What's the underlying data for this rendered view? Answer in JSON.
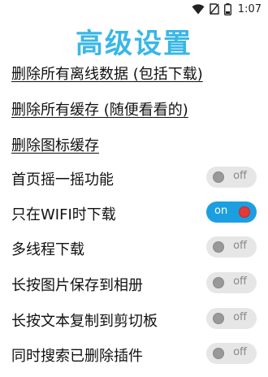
{
  "status_bar": {
    "time": "1:07",
    "battery_level": "1",
    "icons": [
      "wifi-icon",
      "no-sim-icon",
      "battery-icon"
    ]
  },
  "title": "高级设置",
  "links": [
    {
      "label": "删除所有离线数据 (包括下载)"
    },
    {
      "label": "删除所有缓存 (随便看看的)"
    },
    {
      "label": "删除图标缓存"
    }
  ],
  "settings": [
    {
      "label": "首页摇一摇功能",
      "state": "off"
    },
    {
      "label": "只在WIFI时下载",
      "state": "on"
    },
    {
      "label": "多线程下载",
      "state": "off"
    },
    {
      "label": "长按图片保存到相册",
      "state": "off"
    },
    {
      "label": "长按文本复制到剪切板",
      "state": "off"
    },
    {
      "label": "同时搜索已删除插件",
      "state": "off"
    }
  ],
  "colors": {
    "title": "#39b7e6",
    "toggle_on": "#1c9fe0",
    "toggle_off": "#e6e6e6",
    "knob_on": "#e53935"
  }
}
